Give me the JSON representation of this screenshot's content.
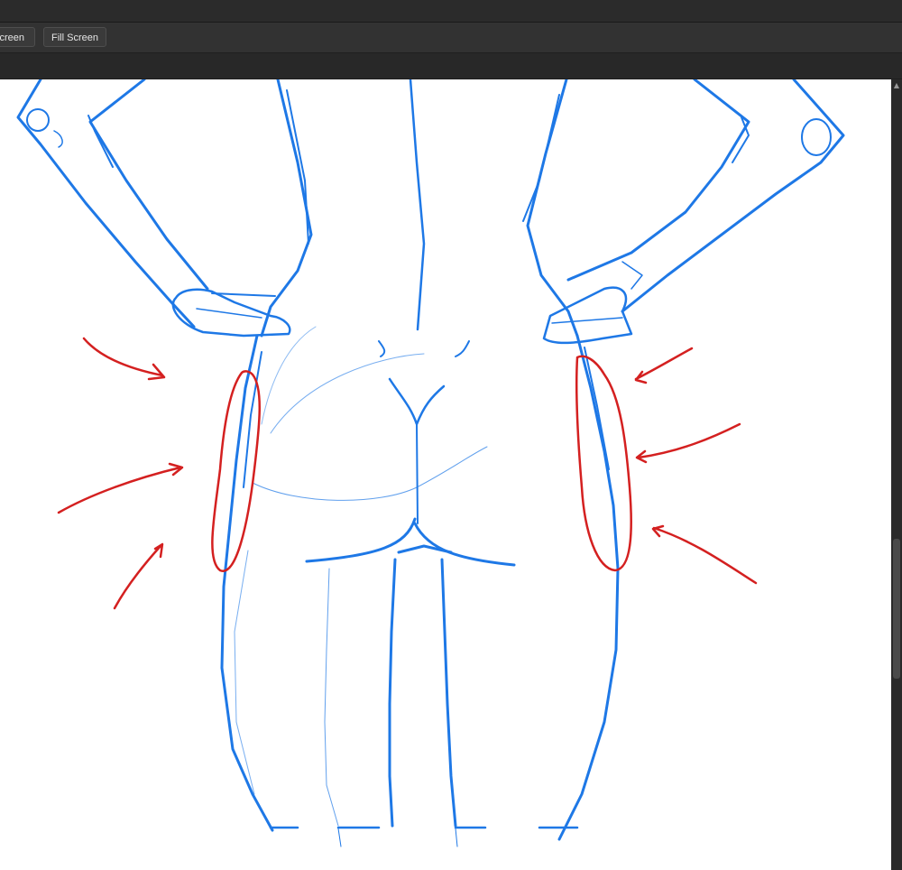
{
  "toolbar": {
    "partial_button_label": "Screen",
    "fill_screen_label": "Fill Screen"
  },
  "scrollbar": {
    "up_arrow_icon": "chevron-up-icon",
    "position": 0.7
  },
  "canvas": {
    "background": "#ffffff",
    "sketch_color": "#1e78e6",
    "annotation_color": "#d42020"
  }
}
